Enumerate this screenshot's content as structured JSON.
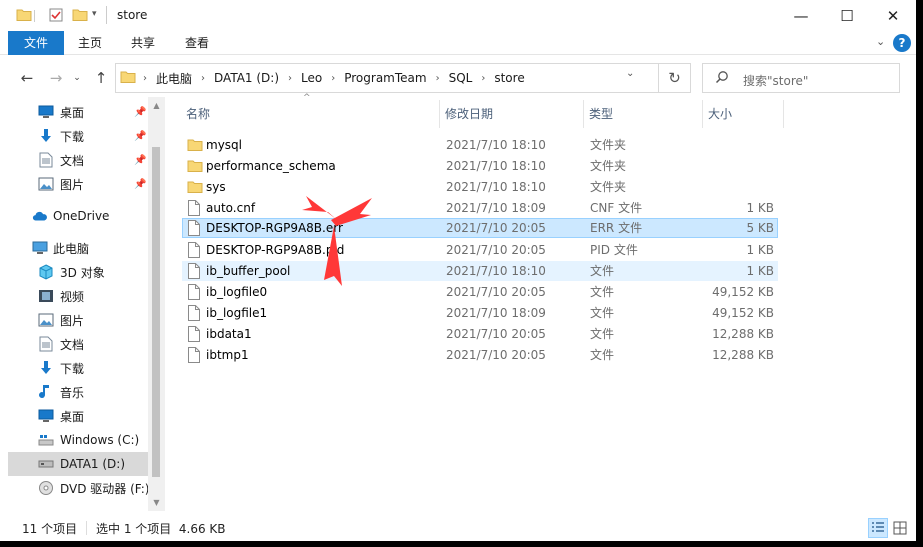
{
  "window": {
    "title": "store",
    "controls": {
      "minimize": "—",
      "maximize": "☐",
      "close": "✕"
    }
  },
  "ribbon": {
    "tabs": [
      {
        "label": "文件",
        "active": true
      },
      {
        "label": "主页"
      },
      {
        "label": "共享"
      },
      {
        "label": "查看"
      }
    ],
    "expand_icon": "chevron-down-icon",
    "help_label": "?"
  },
  "address": {
    "crumbs": [
      "此电脑",
      "DATA1 (D:)",
      "Leo",
      "ProgramTeam",
      "SQL",
      "store"
    ],
    "separator": "›"
  },
  "search": {
    "placeholder": "搜索\"store\""
  },
  "navpane": {
    "items": [
      {
        "label": "桌面",
        "icon": "desktop-icon",
        "pinned": true
      },
      {
        "label": "下载",
        "icon": "download-icon",
        "pinned": true
      },
      {
        "label": "文档",
        "icon": "document-icon",
        "pinned": true
      },
      {
        "label": "图片",
        "icon": "picture-icon",
        "pinned": true
      },
      {
        "label": "OneDrive",
        "icon": "cloud-icon"
      },
      {
        "label": "此电脑",
        "icon": "computer-icon"
      },
      {
        "label": "3D 对象",
        "icon": "cube-icon"
      },
      {
        "label": "视频",
        "icon": "video-icon"
      },
      {
        "label": "图片",
        "icon": "picture-icon"
      },
      {
        "label": "文档",
        "icon": "document-icon"
      },
      {
        "label": "下载",
        "icon": "download-icon"
      },
      {
        "label": "音乐",
        "icon": "music-icon"
      },
      {
        "label": "桌面",
        "icon": "desktop-icon"
      },
      {
        "label": "Windows (C:)",
        "icon": "windows-drive-icon"
      },
      {
        "label": "DATA1 (D:)",
        "icon": "drive-icon",
        "selected": true
      },
      {
        "label": "DVD 驱动器 (F:)",
        "icon": "dvd-icon"
      }
    ]
  },
  "columns": {
    "name": "名称",
    "date": "修改日期",
    "type": "类型",
    "size": "大小"
  },
  "files": [
    {
      "name": "mysql",
      "date": "2021/7/10 18:10",
      "type": "文件夹",
      "size": "",
      "kind": "folder"
    },
    {
      "name": "performance_schema",
      "date": "2021/7/10 18:10",
      "type": "文件夹",
      "size": "",
      "kind": "folder"
    },
    {
      "name": "sys",
      "date": "2021/7/10 18:10",
      "type": "文件夹",
      "size": "",
      "kind": "folder"
    },
    {
      "name": "auto.cnf",
      "date": "2021/7/10 18:09",
      "type": "CNF 文件",
      "size": "1 KB",
      "kind": "file"
    },
    {
      "name": "DESKTOP-RGP9A8B.err",
      "date": "2021/7/10 20:05",
      "type": "ERR 文件",
      "size": "5 KB",
      "kind": "file",
      "selected": true
    },
    {
      "name": "DESKTOP-RGP9A8B.pid",
      "date": "2021/7/10 20:05",
      "type": "PID 文件",
      "size": "1 KB",
      "kind": "file"
    },
    {
      "name": "ib_buffer_pool",
      "date": "2021/7/10 18:10",
      "type": "文件",
      "size": "1 KB",
      "kind": "file",
      "hover": true
    },
    {
      "name": "ib_logfile0",
      "date": "2021/7/10 20:05",
      "type": "文件",
      "size": "49,152 KB",
      "kind": "file"
    },
    {
      "name": "ib_logfile1",
      "date": "2021/7/10 18:09",
      "type": "文件",
      "size": "49,152 KB",
      "kind": "file"
    },
    {
      "name": "ibdata1",
      "date": "2021/7/10 20:05",
      "type": "文件",
      "size": "12,288 KB",
      "kind": "file"
    },
    {
      "name": "ibtmp1",
      "date": "2021/7/10 20:05",
      "type": "文件",
      "size": "12,288 KB",
      "kind": "file"
    }
  ],
  "status": {
    "item_count": "11 个项目",
    "selection": "选中 1 个项目  4.66 KB"
  },
  "colors": {
    "accent": "#1979ca",
    "selection": "#cce8ff",
    "folder": "#f8d775",
    "annotation": "#ff3838"
  }
}
